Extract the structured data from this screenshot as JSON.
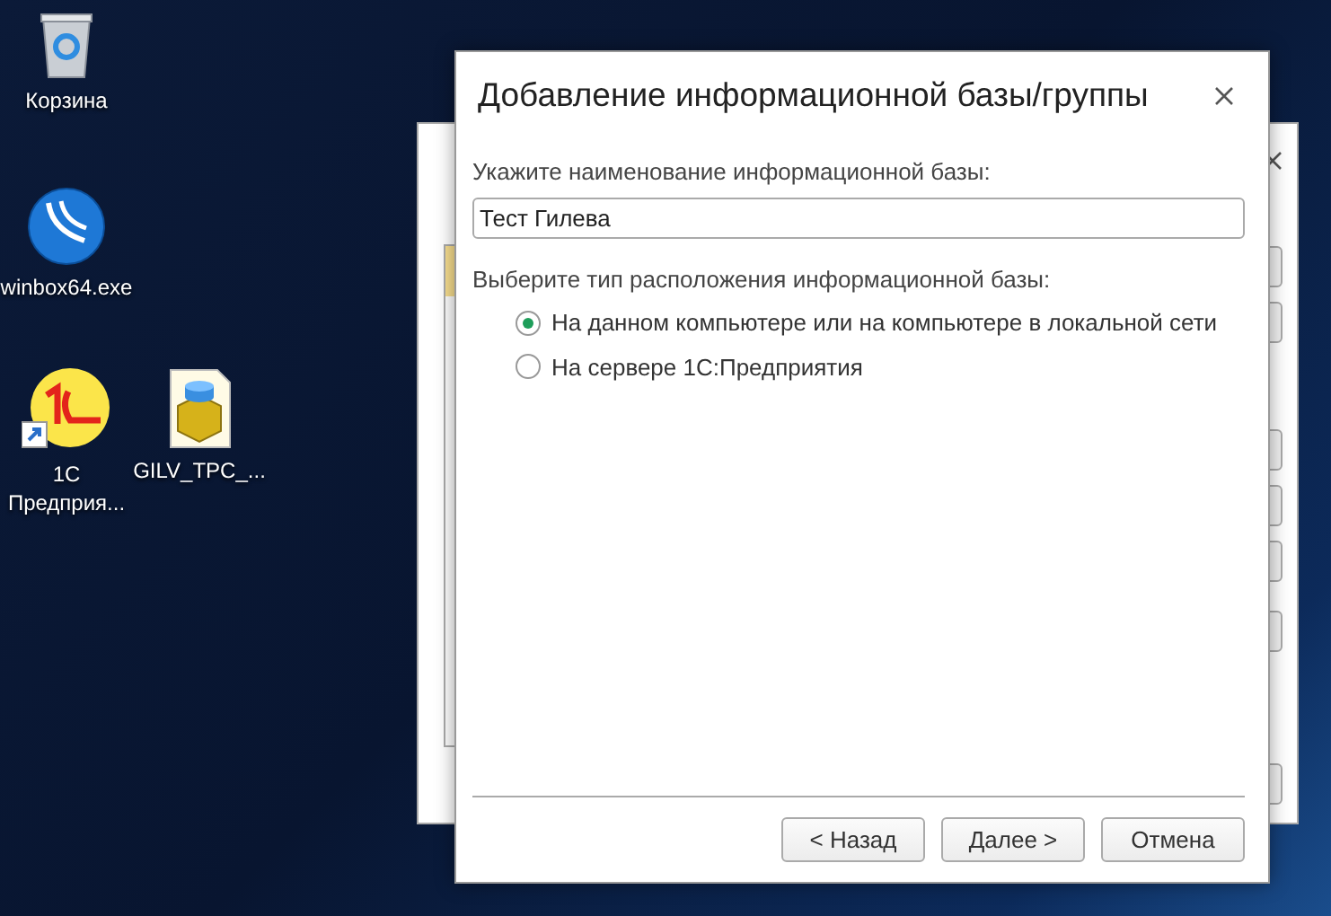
{
  "desktop_icons": [
    {
      "kind": "recycle_bin",
      "label": "Корзина"
    },
    {
      "kind": "winbox",
      "label": "winbox64.exe"
    },
    {
      "kind": "onec",
      "label": "1С Предприя..."
    },
    {
      "kind": "database",
      "label": "GILV_TPC_..."
    }
  ],
  "dialog": {
    "title": "Добавление информационной базы/группы",
    "name_label": "Укажите наименование информационной базы:",
    "name_value": "Тест Гилева",
    "location_label": "Выберите тип расположения информационной базы:",
    "options": [
      {
        "label": "На данном компьютере или на компьютере в локальной сети",
        "selected": true
      },
      {
        "label": "На сервере 1С:Предприятия",
        "selected": false
      }
    ],
    "buttons": [
      "< Назад",
      "Далее >",
      "Отмена"
    ]
  }
}
